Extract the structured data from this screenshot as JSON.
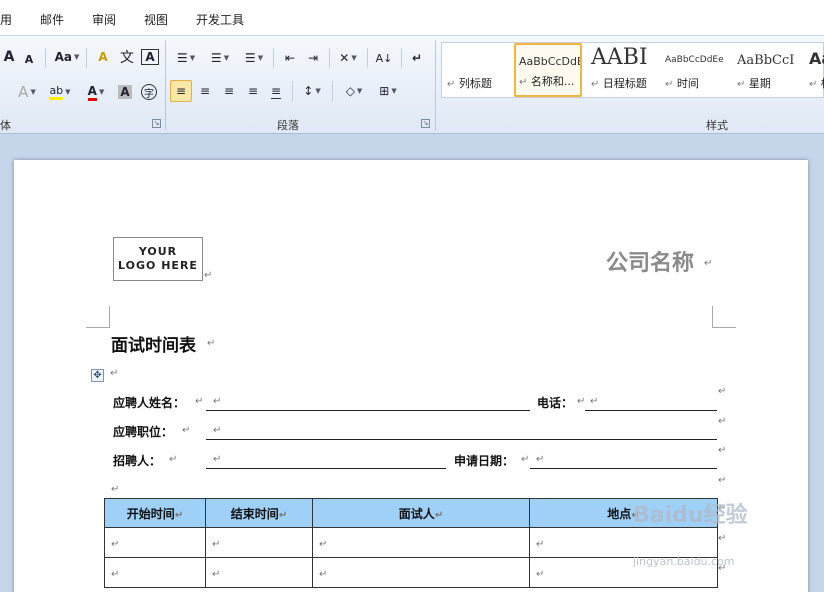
{
  "menu": {
    "tabs": [
      "用",
      "邮件",
      "审阅",
      "视图",
      "开发工具"
    ]
  },
  "ribbon": {
    "groups": {
      "font": "体",
      "paragraph": "段落",
      "styles": "样式"
    },
    "font_buttons": {
      "grow": "A",
      "shrink": "A",
      "change_case": "Aa",
      "clear_format": "A",
      "phonetic": "文",
      "border_char": "A",
      "text_effect": "A",
      "highlight": "ab",
      "font_color": "A",
      "char_shading": "A",
      "enclose_char": "字"
    },
    "paragraph_buttons": {
      "bullets": "☰",
      "numbering": "☰",
      "multilevel": "☰",
      "decrease_indent": "⇤",
      "increase_indent": "⇥",
      "chinese_layout": "✕",
      "sort": "A↓",
      "show_marks": "↵",
      "align_left": "≡",
      "center": "≡",
      "align_right": "≡",
      "justify": "≡",
      "distributed": "≡",
      "line_spacing": "↕",
      "shading": "◇",
      "borders": "⊞"
    },
    "styles": [
      {
        "preview": "",
        "label": "列标题"
      },
      {
        "preview": "AaBbCcDdE",
        "label": "名称和..."
      },
      {
        "preview": "AABI",
        "label": "日程标题"
      },
      {
        "preview": "AaBbCcDdEe",
        "label": "时间"
      },
      {
        "preview": "AaBbCcI",
        "label": "星期"
      },
      {
        "preview": "Aa",
        "label": "标"
      }
    ]
  },
  "document": {
    "logo": "YOUR LOGO HERE",
    "company_name": "公司名称",
    "title": "面试时间表",
    "return_mark": "↵",
    "fields": {
      "applicant_name": "应聘人姓名：",
      "phone": "电话：",
      "position": "应聘职位：",
      "recruiter": "招聘人：",
      "apply_date": "申请日期："
    },
    "table": {
      "headers": [
        "开始时间",
        "结束时间",
        "面试人",
        "地点"
      ]
    }
  },
  "watermark": {
    "text": "Baidu经验",
    "sub": "jingyan.baidu.com"
  },
  "colors": {
    "table_header": "#9fd0f7",
    "selected_style": "#f2b63d",
    "company": "#8a8a8a"
  }
}
